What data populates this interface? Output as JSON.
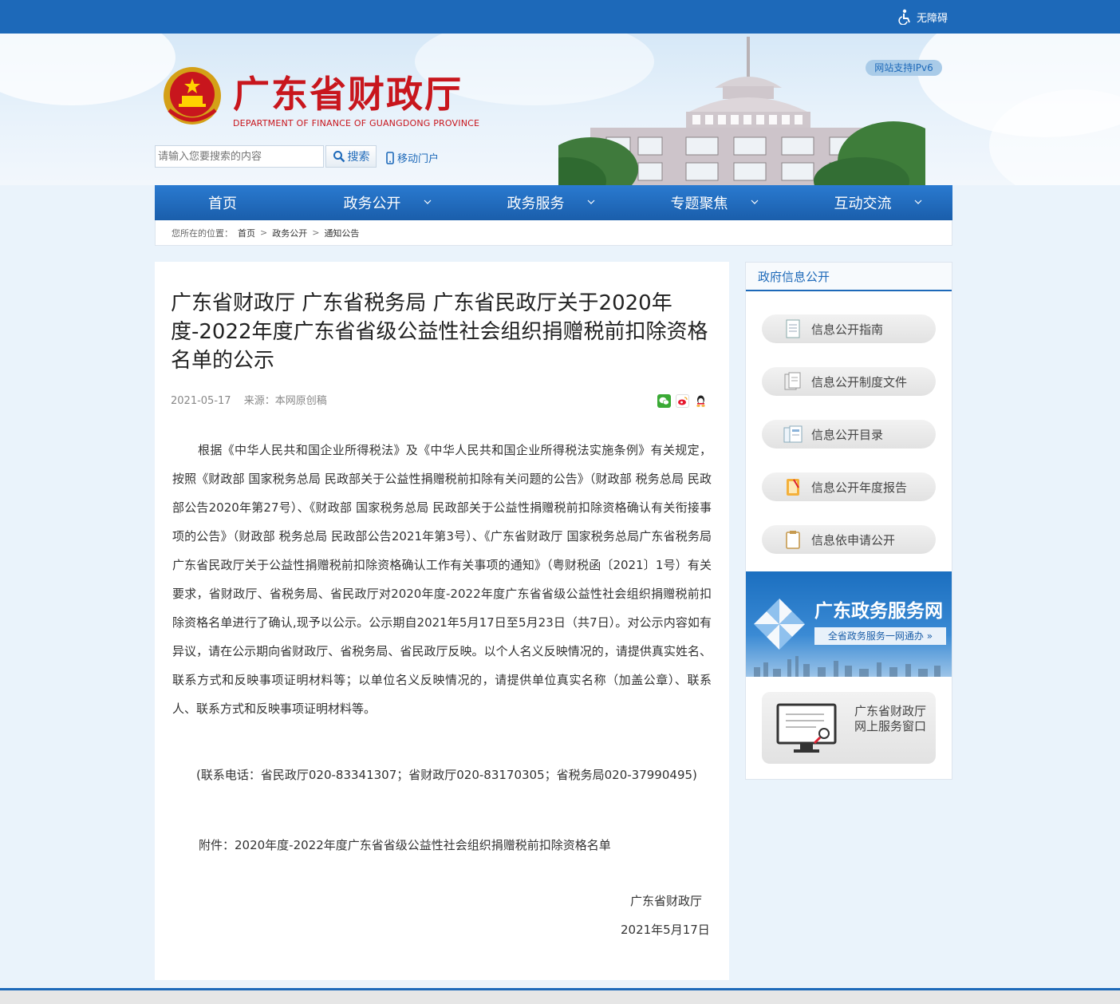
{
  "topbar": {
    "accessibility": "无障碍"
  },
  "header": {
    "title": "广东省财政厅",
    "subtitle": "DEPARTMENT OF FINANCE OF GUANGDONG PROVINCE",
    "ipv6": "网站支持IPv6",
    "search_placeholder": "请输入您要搜索的内容",
    "search_button": "搜索",
    "mobile": "移动门户"
  },
  "nav": [
    {
      "label": "首页"
    },
    {
      "label": "政务公开"
    },
    {
      "label": "政务服务"
    },
    {
      "label": "专题聚焦"
    },
    {
      "label": "互动交流"
    }
  ],
  "breadcrumb": {
    "prefix": "您所在的位置：",
    "items": [
      "首页",
      "政务公开",
      "通知公告"
    ],
    "sep": ">"
  },
  "article": {
    "title": "广东省财政厅 广东省税务局 广东省民政厅关于2020年度-2022年度广东省省级公益性社会组织捐赠税前扣除资格名单的公示",
    "date": "2021-05-17",
    "source": "来源：本网原创稿",
    "body": "根据《中华人民共和国企业所得税法》及《中华人民共和国企业所得税法实施条例》有关规定，按照《财政部 国家税务总局 民政部关于公益性捐赠税前扣除有关问题的公告》（财政部 税务总局 民政部公告2020年第27号）、《财政部 国家税务总局 民政部关于公益性捐赠税前扣除资格确认有关衔接事项的公告》（财政部 税务总局 民政部公告2021年第3号）、《广东省财政厅 国家税务总局广东省税务局 广东省民政厅关于公益性捐赠税前扣除资格确认工作有关事项的通知》（粤财税函〔2021〕1号）有关要求，省财政厅、省税务局、省民政厅对2020年度-2022年度广东省省级公益性社会组织捐赠税前扣除资格名单进行了确认,现予以公示。公示期自2021年5月17日至5月23日（共7日）。对公示内容如有异议，请在公示期向省财政厅、省税务局、省民政厅反映。以个人名义反映情况的，请提供真实姓名、联系方式和反映事项证明材料等；以单位名义反映情况的，请提供单位真实名称（加盖公章）、联系人、联系方式和反映事项证明材料等。",
    "phone": "(联系电话：省民政厅020-83341307；省财政厅020-83170305；省税务局020-37990495)",
    "attachment": "附件：2020年度-2022年度广东省省级公益性社会组织捐赠税前扣除资格名单",
    "signature": "广东省财政厅",
    "sign_date": "2021年5月17日"
  },
  "sidebar": {
    "heading": "政府信息公开",
    "links": [
      {
        "label": "信息公开指南"
      },
      {
        "label": "信息公开制度文件"
      },
      {
        "label": "信息公开目录"
      },
      {
        "label": "信息公开年度报告"
      },
      {
        "label": "信息依申请公开"
      }
    ],
    "banner_title": "广东政务服务网",
    "banner_sub": "全省政务服务一网通办 »",
    "window": "广东省财政厅网上服务窗口"
  },
  "colors": {
    "brand_blue": "#1d69b9",
    "title_red": "#c8161d"
  }
}
